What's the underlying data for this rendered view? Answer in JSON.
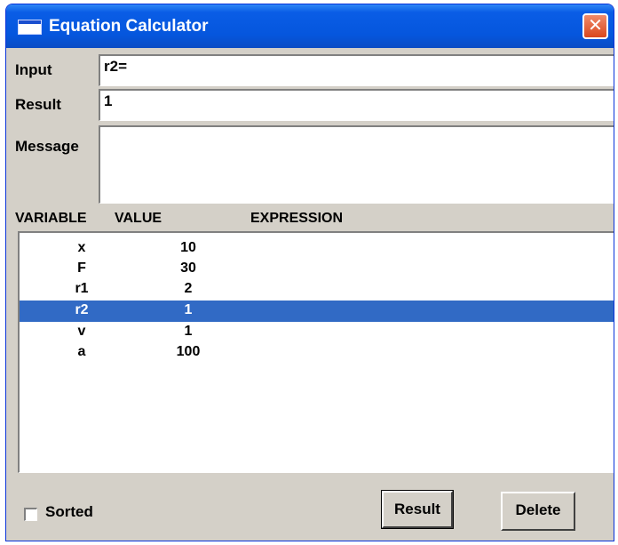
{
  "window": {
    "title": "Equation Calculator",
    "close_glyph": "✕"
  },
  "form": {
    "input_label": "Input",
    "input_value": "r2=",
    "result_label": "Result",
    "result_value": "1",
    "message_label": "Message",
    "message_value": ""
  },
  "table": {
    "headers": {
      "variable": "VARIABLE",
      "value": "VALUE",
      "expression": "EXPRESSION"
    },
    "rows": [
      {
        "variable": "x",
        "value": "10",
        "expression": ""
      },
      {
        "variable": "F",
        "value": "30",
        "expression": ""
      },
      {
        "variable": "r1",
        "value": "2",
        "expression": ""
      },
      {
        "variable": "r2",
        "value": "1",
        "expression": "",
        "selected": true
      },
      {
        "variable": "v",
        "value": "1",
        "expression": ""
      },
      {
        "variable": "a",
        "value": "100",
        "expression": ""
      }
    ]
  },
  "footer": {
    "sorted_label": "Sorted",
    "sorted_checked": false,
    "result_button": "Result",
    "delete_button": "Delete"
  },
  "colors": {
    "titlebar": "#0556dd",
    "selection": "#316ac5",
    "face": "#d4d0c8"
  }
}
